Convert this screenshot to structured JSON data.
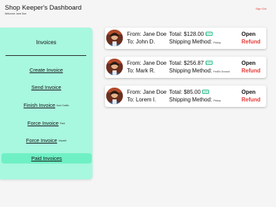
{
  "header": {
    "title": "Shop Keeper's Dashboard",
    "welcome": "Welcome Jane Doe",
    "sign_out": "Sign Out"
  },
  "sidebar": {
    "title": "Invoices",
    "items": [
      {
        "label": "Create Invoice",
        "sub": ""
      },
      {
        "label": "Send Invoice",
        "sub": ""
      },
      {
        "label": "Finish Invoice",
        "sub": "from Drafts"
      },
      {
        "label": "Force Invoice",
        "sub": "Paid"
      },
      {
        "label": "Force Invoice",
        "sub": "Unpaid"
      },
      {
        "label": "Paid Invoices",
        "sub": ""
      }
    ]
  },
  "invoices": [
    {
      "from": "From: Jane Doe",
      "to": "To: John D.",
      "total": "Total: $128.00",
      "status_tag": "paid",
      "shipping_label": "Shipping Method:",
      "shipping_method": "Pickup",
      "open": "Open",
      "refund": "Refund"
    },
    {
      "from": "From: Jane Doe",
      "to": "To: Mark R.",
      "total": "Total: $256.87",
      "status_tag": "paid",
      "shipping_label": "Shipping Method:",
      "shipping_method": "FedEx Ground",
      "open": "Open",
      "refund": "Refund"
    },
    {
      "from": "From: Jane Doe",
      "to": "To: Lorem I.",
      "total": "Total: $85.00",
      "status_tag": "paid",
      "shipping_label": "Shipping Method:",
      "shipping_method": "Pickup",
      "open": "Open",
      "refund": "Refund"
    }
  ],
  "colors": {
    "sidebar_bg": "#a8f7df",
    "active_item_bg": "#6ff0c4",
    "refund": "#e53935",
    "paid_tag": "#1bb985"
  },
  "icons": {
    "avatar": "user-avatar-icon"
  }
}
